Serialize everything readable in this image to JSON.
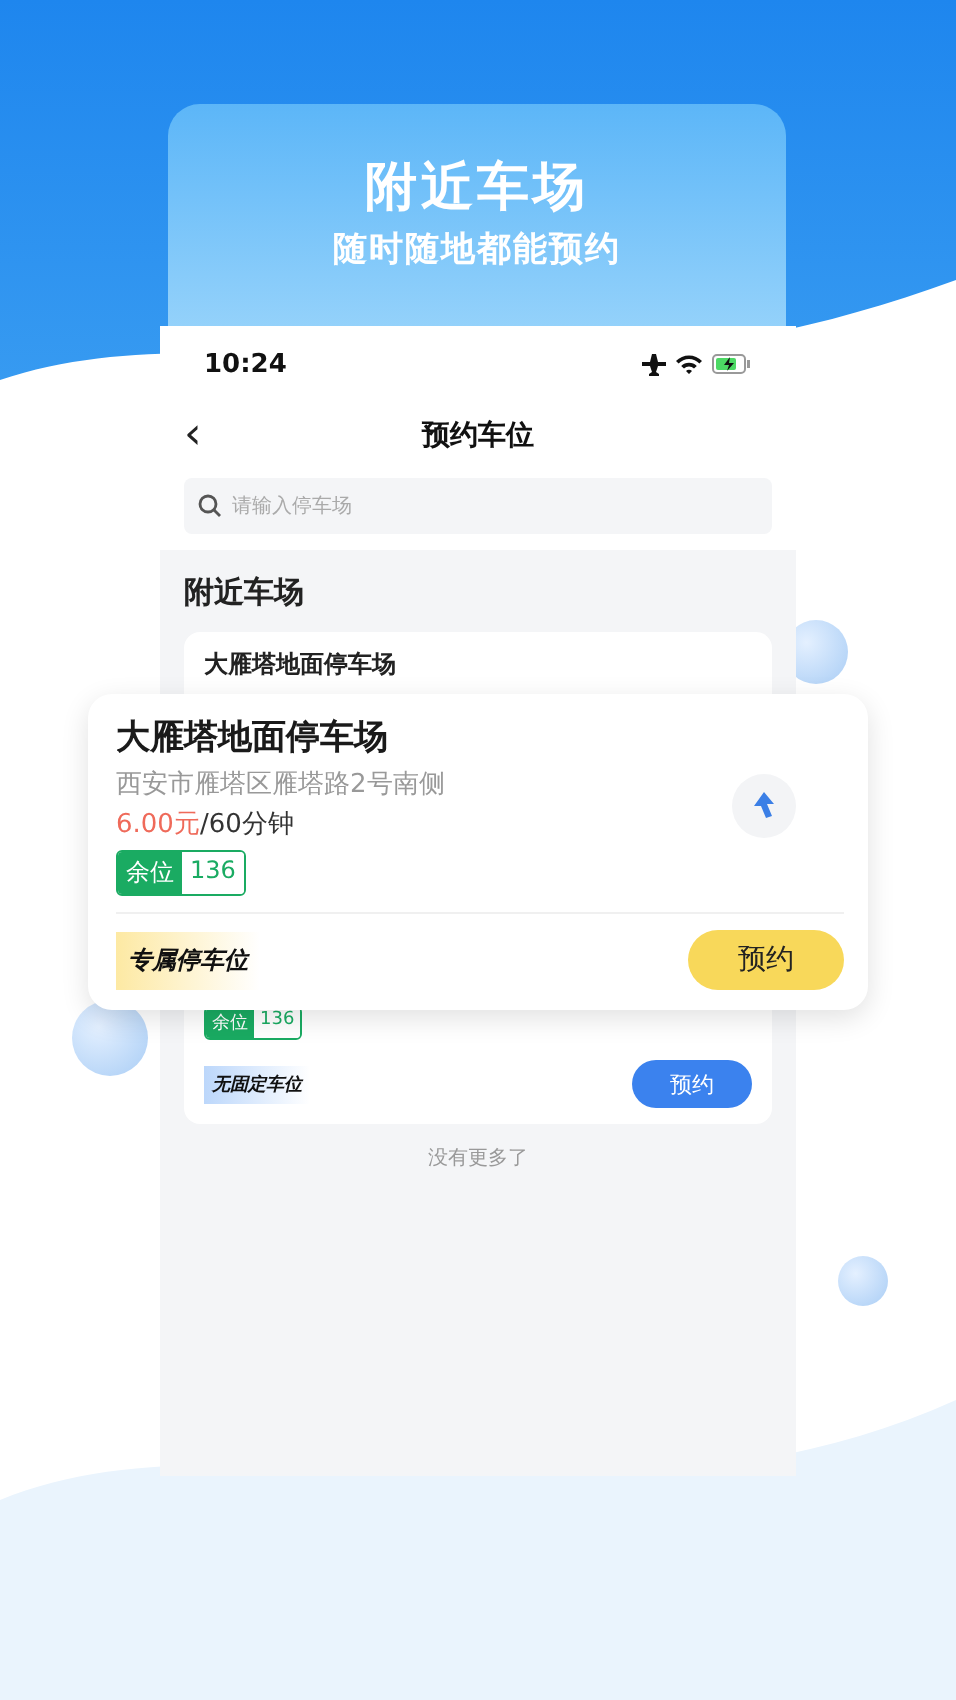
{
  "header": {
    "title": "附近车场",
    "subtitle": "随时随地都能预约"
  },
  "phone": {
    "status_bar": {
      "time": "10:24"
    },
    "nav": {
      "back": "‹",
      "title": "预约车位"
    },
    "search": {
      "placeholder": "请输入停车场"
    },
    "section_title": "附近车场",
    "card": {
      "name": "大雁塔地面停车场",
      "spaces_label": "余位",
      "spaces": "136",
      "tag": "无固定车位",
      "button": "预约"
    },
    "footer": "没有更多了"
  },
  "popup": {
    "name": "大雁塔地面停车场",
    "address": "西安市雁塔区雁塔路2号南侧",
    "price": "6.00元",
    "price_unit": "/60分钟",
    "spaces_label": "余位",
    "spaces": "136",
    "tag": "专属停车位",
    "button": "预约"
  }
}
